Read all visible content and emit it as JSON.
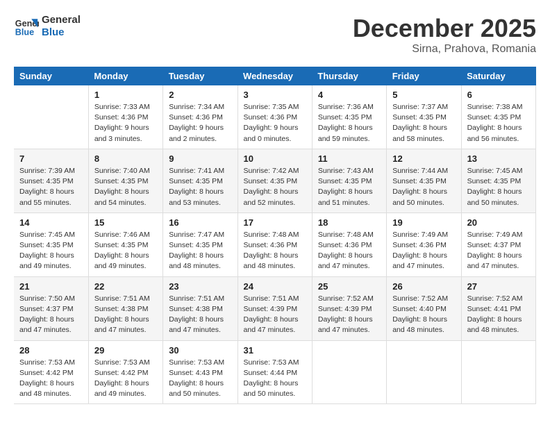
{
  "header": {
    "logo_line1": "General",
    "logo_line2": "Blue",
    "month": "December 2025",
    "location": "Sirna, Prahova, Romania"
  },
  "days_header": [
    "Sunday",
    "Monday",
    "Tuesday",
    "Wednesday",
    "Thursday",
    "Friday",
    "Saturday"
  ],
  "weeks": [
    [
      {
        "day": "",
        "info": ""
      },
      {
        "day": "1",
        "info": "Sunrise: 7:33 AM\nSunset: 4:36 PM\nDaylight: 9 hours\nand 3 minutes."
      },
      {
        "day": "2",
        "info": "Sunrise: 7:34 AM\nSunset: 4:36 PM\nDaylight: 9 hours\nand 2 minutes."
      },
      {
        "day": "3",
        "info": "Sunrise: 7:35 AM\nSunset: 4:36 PM\nDaylight: 9 hours\nand 0 minutes."
      },
      {
        "day": "4",
        "info": "Sunrise: 7:36 AM\nSunset: 4:35 PM\nDaylight: 8 hours\nand 59 minutes."
      },
      {
        "day": "5",
        "info": "Sunrise: 7:37 AM\nSunset: 4:35 PM\nDaylight: 8 hours\nand 58 minutes."
      },
      {
        "day": "6",
        "info": "Sunrise: 7:38 AM\nSunset: 4:35 PM\nDaylight: 8 hours\nand 56 minutes."
      }
    ],
    [
      {
        "day": "7",
        "info": "Sunrise: 7:39 AM\nSunset: 4:35 PM\nDaylight: 8 hours\nand 55 minutes."
      },
      {
        "day": "8",
        "info": "Sunrise: 7:40 AM\nSunset: 4:35 PM\nDaylight: 8 hours\nand 54 minutes."
      },
      {
        "day": "9",
        "info": "Sunrise: 7:41 AM\nSunset: 4:35 PM\nDaylight: 8 hours\nand 53 minutes."
      },
      {
        "day": "10",
        "info": "Sunrise: 7:42 AM\nSunset: 4:35 PM\nDaylight: 8 hours\nand 52 minutes."
      },
      {
        "day": "11",
        "info": "Sunrise: 7:43 AM\nSunset: 4:35 PM\nDaylight: 8 hours\nand 51 minutes."
      },
      {
        "day": "12",
        "info": "Sunrise: 7:44 AM\nSunset: 4:35 PM\nDaylight: 8 hours\nand 50 minutes."
      },
      {
        "day": "13",
        "info": "Sunrise: 7:45 AM\nSunset: 4:35 PM\nDaylight: 8 hours\nand 50 minutes."
      }
    ],
    [
      {
        "day": "14",
        "info": "Sunrise: 7:45 AM\nSunset: 4:35 PM\nDaylight: 8 hours\nand 49 minutes."
      },
      {
        "day": "15",
        "info": "Sunrise: 7:46 AM\nSunset: 4:35 PM\nDaylight: 8 hours\nand 49 minutes."
      },
      {
        "day": "16",
        "info": "Sunrise: 7:47 AM\nSunset: 4:35 PM\nDaylight: 8 hours\nand 48 minutes."
      },
      {
        "day": "17",
        "info": "Sunrise: 7:48 AM\nSunset: 4:36 PM\nDaylight: 8 hours\nand 48 minutes."
      },
      {
        "day": "18",
        "info": "Sunrise: 7:48 AM\nSunset: 4:36 PM\nDaylight: 8 hours\nand 47 minutes."
      },
      {
        "day": "19",
        "info": "Sunrise: 7:49 AM\nSunset: 4:36 PM\nDaylight: 8 hours\nand 47 minutes."
      },
      {
        "day": "20",
        "info": "Sunrise: 7:49 AM\nSunset: 4:37 PM\nDaylight: 8 hours\nand 47 minutes."
      }
    ],
    [
      {
        "day": "21",
        "info": "Sunrise: 7:50 AM\nSunset: 4:37 PM\nDaylight: 8 hours\nand 47 minutes."
      },
      {
        "day": "22",
        "info": "Sunrise: 7:51 AM\nSunset: 4:38 PM\nDaylight: 8 hours\nand 47 minutes."
      },
      {
        "day": "23",
        "info": "Sunrise: 7:51 AM\nSunset: 4:38 PM\nDaylight: 8 hours\nand 47 minutes."
      },
      {
        "day": "24",
        "info": "Sunrise: 7:51 AM\nSunset: 4:39 PM\nDaylight: 8 hours\nand 47 minutes."
      },
      {
        "day": "25",
        "info": "Sunrise: 7:52 AM\nSunset: 4:39 PM\nDaylight: 8 hours\nand 47 minutes."
      },
      {
        "day": "26",
        "info": "Sunrise: 7:52 AM\nSunset: 4:40 PM\nDaylight: 8 hours\nand 48 minutes."
      },
      {
        "day": "27",
        "info": "Sunrise: 7:52 AM\nSunset: 4:41 PM\nDaylight: 8 hours\nand 48 minutes."
      }
    ],
    [
      {
        "day": "28",
        "info": "Sunrise: 7:53 AM\nSunset: 4:42 PM\nDaylight: 8 hours\nand 48 minutes."
      },
      {
        "day": "29",
        "info": "Sunrise: 7:53 AM\nSunset: 4:42 PM\nDaylight: 8 hours\nand 49 minutes."
      },
      {
        "day": "30",
        "info": "Sunrise: 7:53 AM\nSunset: 4:43 PM\nDaylight: 8 hours\nand 50 minutes."
      },
      {
        "day": "31",
        "info": "Sunrise: 7:53 AM\nSunset: 4:44 PM\nDaylight: 8 hours\nand 50 minutes."
      },
      {
        "day": "",
        "info": ""
      },
      {
        "day": "",
        "info": ""
      },
      {
        "day": "",
        "info": ""
      }
    ]
  ]
}
